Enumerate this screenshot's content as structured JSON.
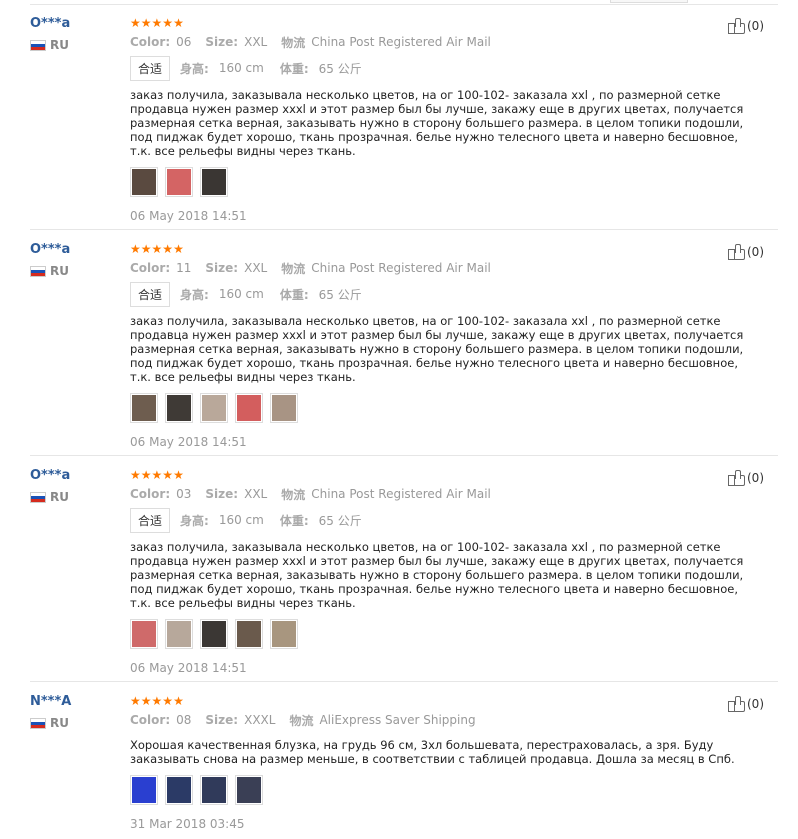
{
  "reviews": [
    {
      "user": "O***a",
      "country": "RU",
      "stars": 5,
      "color_label": "Color:",
      "color_value": "06",
      "size_label": "Size:",
      "size_value": "XXL",
      "logistics_label": "物流",
      "logistics_value": "China Post Registered Air Mail",
      "fit_tag": "合适",
      "height_label": "身高:",
      "height_value": "160 cm",
      "weight_label": "体重:",
      "weight_value": "65 公斤",
      "text": "заказ получила, заказывала несколько цветов, на ог 100-102- заказала xxl , по размерной сетке продавца нужен размер xxxl и этот размер был бы лучше, закажу еще в других цветах, получается размерная сетка верная, заказывать нужно в сторону большего размера. в целом топики подошли, под пиджак будет хорошо, ткань прозрачная. белье нужно телесного цвета и наверно бесшовное, т.к. все рельефы видны через ткань.",
      "photos": [
        "#5a4a40",
        "#d46464",
        "#3a3633"
      ],
      "date": "06 May 2018 14:51",
      "helpful": "(0)"
    },
    {
      "user": "O***a",
      "country": "RU",
      "stars": 5,
      "color_label": "Color:",
      "color_value": "11",
      "size_label": "Size:",
      "size_value": "XXL",
      "logistics_label": "物流",
      "logistics_value": "China Post Registered Air Mail",
      "fit_tag": "合适",
      "height_label": "身高:",
      "height_value": "160 cm",
      "weight_label": "体重:",
      "weight_value": "65 公斤",
      "text": "заказ получила, заказывала несколько цветов, на ог 100-102- заказала xxl , по размерной сетке продавца нужен размер xxxl и этот размер был бы лучше, закажу еще в других цветах, получается размерная сетка верная, заказывать нужно в сторону большего размера. в целом топики подошли, под пиджак будет хорошо, ткань прозрачная. белье нужно телесного цвета и наверно бесшовное, т.к. все рельефы видны через ткань.",
      "photos": [
        "#6e5d4f",
        "#3f3a36",
        "#b9a89a",
        "#d35e5e",
        "#a89484"
      ],
      "date": "06 May 2018 14:51",
      "helpful": "(0)"
    },
    {
      "user": "O***a",
      "country": "RU",
      "stars": 5,
      "color_label": "Color:",
      "color_value": "03",
      "size_label": "Size:",
      "size_value": "XXL",
      "logistics_label": "物流",
      "logistics_value": "China Post Registered Air Mail",
      "fit_tag": "合适",
      "height_label": "身高:",
      "height_value": "160 cm",
      "weight_label": "体重:",
      "weight_value": "65 公斤",
      "text": "заказ получила, заказывала несколько цветов, на ог 100-102- заказала xxl , по размерной сетке продавца нужен размер xxxl и этот размер был бы лучше, закажу еще в других цветах, получается размерная сетка верная, заказывать нужно в сторону большего размера. в целом топики подошли, под пиджак будет хорошо, ткань прозрачная. белье нужно телесного цвета и наверно бесшовное, т.к. все рельефы видны через ткань.",
      "photos": [
        "#cf6a6a",
        "#b7a89b",
        "#3b3734",
        "#6a5a4c",
        "#a8967f"
      ],
      "date": "06 May 2018 14:51",
      "helpful": "(0)"
    },
    {
      "user": "N***A",
      "country": "RU",
      "stars": 5,
      "color_label": "Color:",
      "color_value": "08",
      "size_label": "Size:",
      "size_value": "XXXL",
      "logistics_label": "物流",
      "logistics_value": "AliExpress Saver Shipping",
      "fit_tag": "",
      "height_label": "",
      "height_value": "",
      "weight_label": "",
      "weight_value": "",
      "text": "Хорошая качественная блузка, на грудь 96 см, 3хл большевата, перестраховалась, а зря. Буду заказывать снова на размер меньше, в соответствии с таблицей продавца. Дошла за месяц в Спб.",
      "photos": [
        "#2a3fd0",
        "#2b3a66",
        "#303a5a",
        "#3a3f55"
      ],
      "date": "31 Mar 2018 03:45",
      "helpful": "(0)"
    }
  ]
}
